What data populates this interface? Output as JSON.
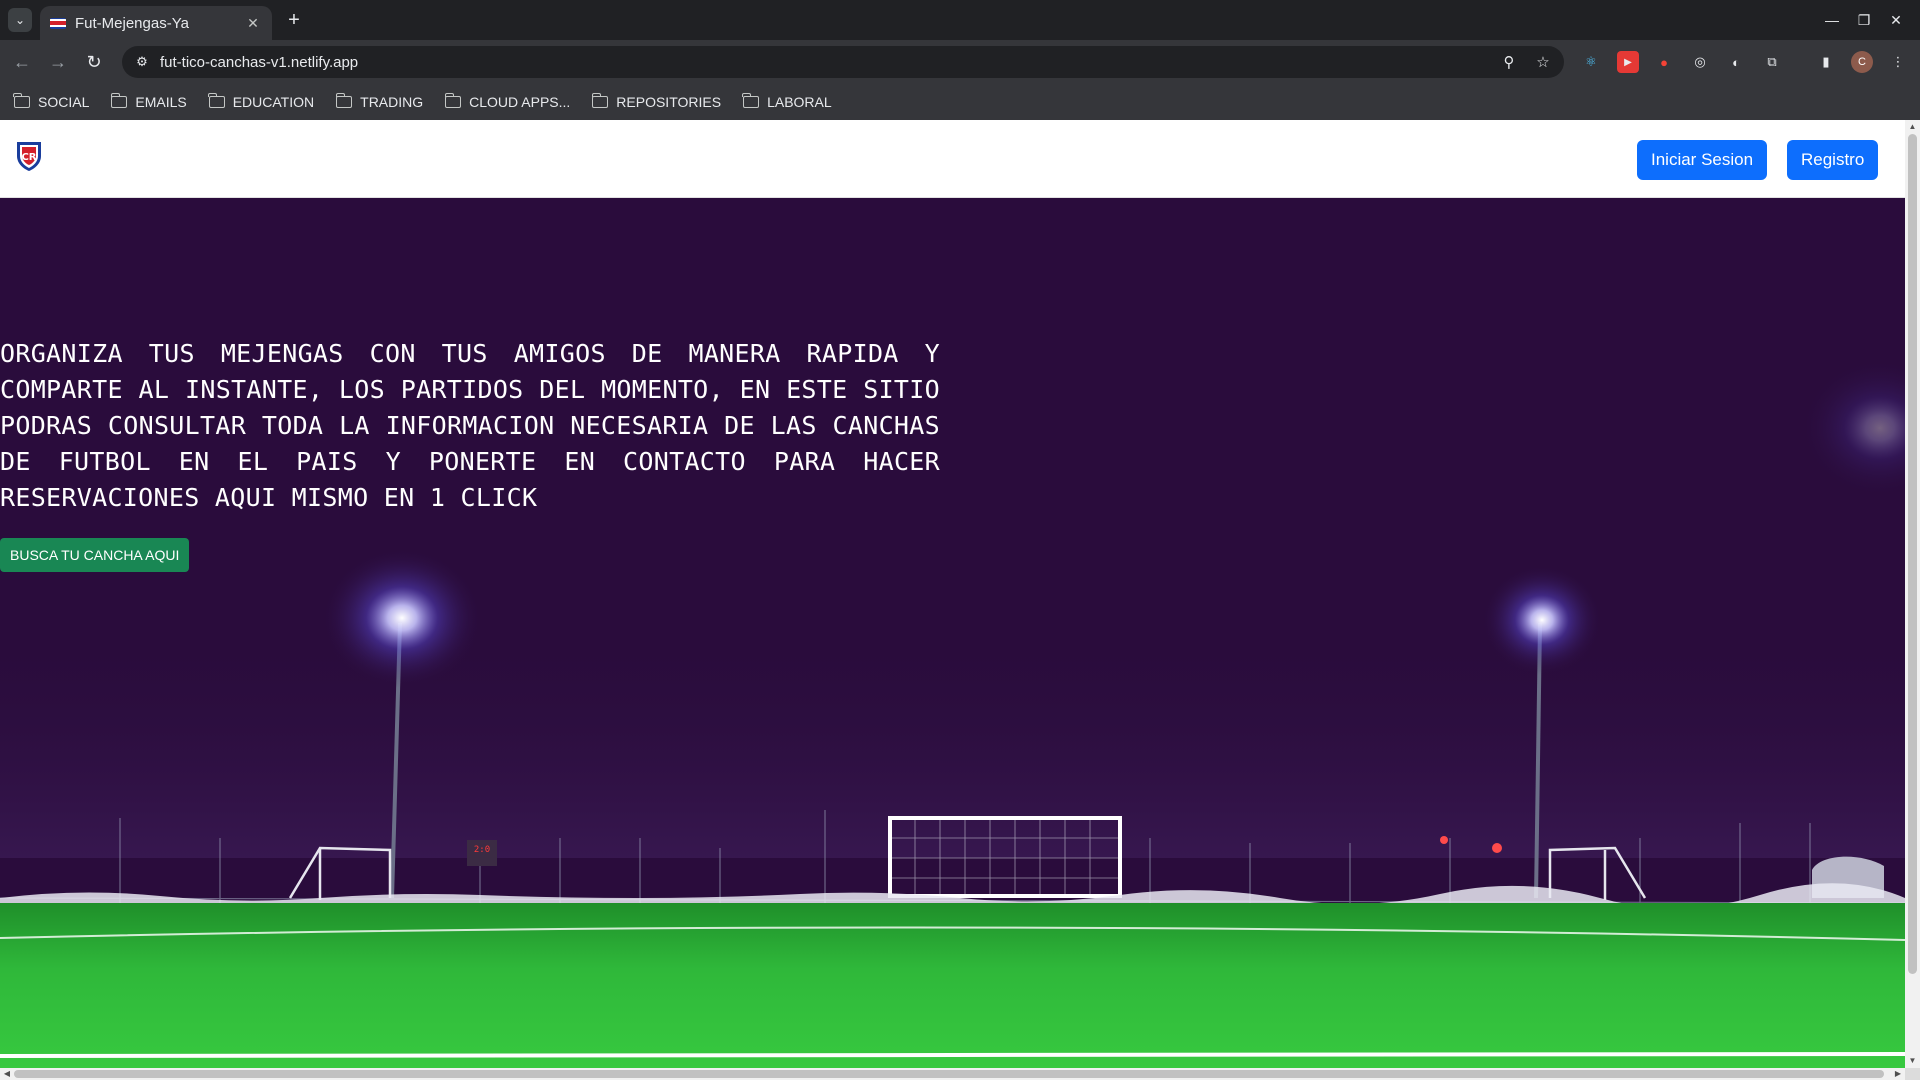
{
  "browser": {
    "tab": {
      "title": "Fut-Mejengas-Ya"
    },
    "address_bar": {
      "url": "fut-tico-canchas-v1.netlify.app"
    },
    "bookmarks": [
      {
        "label": "SOCIAL"
      },
      {
        "label": "EMAILS"
      },
      {
        "label": "EDUCATION"
      },
      {
        "label": "TRADING"
      },
      {
        "label": "CLOUD APPS..."
      },
      {
        "label": "REPOSITORIES"
      },
      {
        "label": "LABORAL"
      }
    ],
    "profile_initial": "C"
  },
  "site": {
    "logo_text": "CR",
    "nav": {
      "login_label": "Iniciar Sesion",
      "register_label": "Registro"
    },
    "hero": {
      "text": "ORGANIZA TUS MEJENGAS CON TUS AMIGOS DE MANERA RAPIDA Y COMPARTE AL INSTANTE, LOS PARTIDOS DEL MOMENTO, EN ESTE SITIO PODRAS CONSULTAR TODA LA INFORMACION NECESARIA DE LAS CANCHAS DE FUTBOL EN EL PAIS Y PONERTE EN CONTACTO PARA HACER RESERVACIONES AQUI MISMO EN 1 CLICK",
      "cta_label": "BUSCA TU CANCHA AQUI",
      "scoreboard_text": "2:0"
    }
  },
  "colors": {
    "primary": "#0d6efd",
    "success": "#198754",
    "hero_sky": "#2a0c3c",
    "pitch_green": "#2fb83a"
  }
}
